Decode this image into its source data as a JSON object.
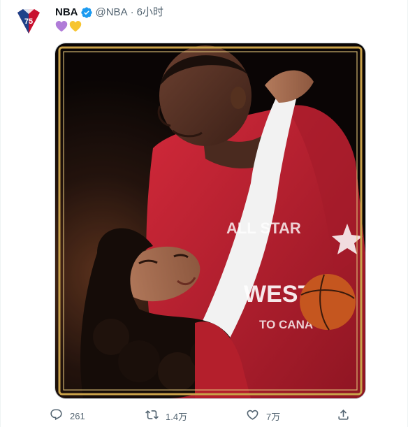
{
  "tweet": {
    "author": {
      "display_name": "NBA",
      "handle": "@NBA",
      "verified": true,
      "avatar_icon": "nba-75-logo-icon"
    },
    "separator": "·",
    "time": "6小时",
    "text_emojis": [
      "purple-heart-icon",
      "yellow-heart-icon"
    ],
    "media": {
      "type": "photo",
      "frame_color": "#c9a24a",
      "jersey_text_1": "ALL STAR",
      "jersey_text_2": "WEST",
      "jersey_text_3": "TO CANA"
    },
    "actions": {
      "reply": {
        "icon": "reply-icon",
        "count": "261"
      },
      "retweet": {
        "icon": "retweet-icon",
        "count": "1.4万"
      },
      "like": {
        "icon": "heart-icon",
        "count": "7万"
      },
      "share": {
        "icon": "share-icon"
      }
    }
  },
  "colors": {
    "secondary_text": "#536471",
    "verified_blue": "#1d9bf0",
    "purple_heart": "#b07cd8",
    "yellow_heart": "#f7c531"
  }
}
